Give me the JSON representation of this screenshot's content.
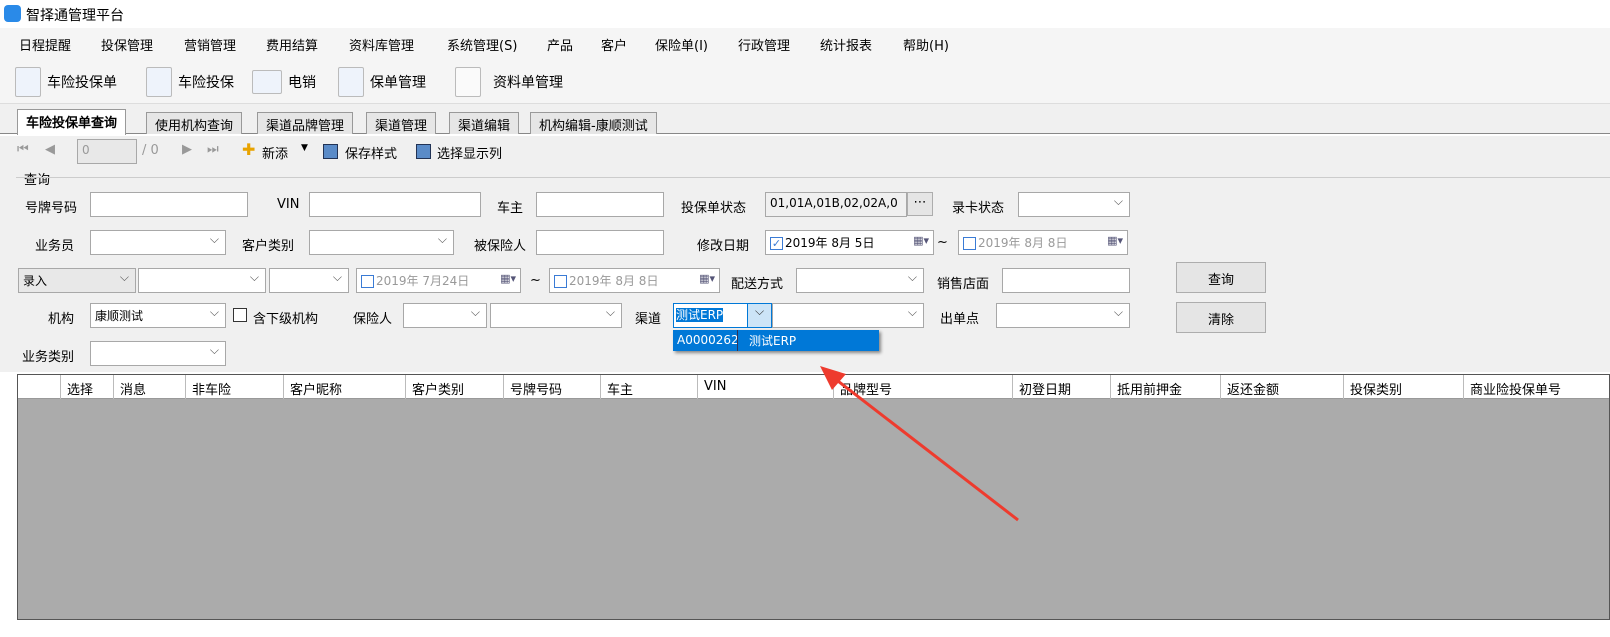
{
  "app": {
    "title": "智择通管理平台"
  },
  "menu": [
    "日程提醒",
    "投保管理",
    "营销管理",
    "费用结算",
    "资料库管理",
    "系统管理(S)",
    "产品",
    "客户",
    "保险单(I)",
    "行政管理",
    "统计报表",
    "帮助(H)"
  ],
  "toolbar": [
    "车险投保单",
    "车险投保",
    "电销",
    "保单管理",
    "资料单管理"
  ],
  "tabs": [
    "车险投保单查询",
    "使用机构查询",
    "渠道品牌管理",
    "渠道管理",
    "渠道编辑",
    "机构编辑-康顺测试"
  ],
  "nav": {
    "page": "0",
    "total": "/ 0",
    "new": "新添",
    "save_style": "保存样式",
    "select_cols": "选择显示列"
  },
  "form": {
    "group": "查询",
    "plate_label": "号牌号码",
    "vin_label": "VIN",
    "owner_label": "车主",
    "status_label": "投保单状态",
    "status_value": "01,01A,01B,02,02A,0",
    "card_label": "录卡状态",
    "salesman_label": "业务员",
    "cust_type_label": "客户类别",
    "insured_label": "被保险人",
    "modify_label": "修改日期",
    "modify_from": "2019年  8月  5日",
    "modify_to": "2019年  8月  8日",
    "tilde": "~",
    "entry_select": "录入",
    "entry_from": "2019年  7月24日",
    "entry_to": "2019年  8月  8日",
    "delivery_label": "配送方式",
    "store_label": "销售店面",
    "org_label": "机构",
    "org_value": "康顺测试",
    "sub_org_label": "含下级机构",
    "insurer_label": "保险人",
    "channel_label": "渠道",
    "channel_value": "测试ERP",
    "outlet_label": "出单点",
    "biz_type_label": "业务类别",
    "query_btn": "查询",
    "clear_btn": "清除"
  },
  "dropdown": {
    "code": "A0000262",
    "name": "测试ERP"
  },
  "grid": {
    "columns": [
      "选择",
      "消息",
      "非车险",
      "客户昵称",
      "客户类别",
      "号牌号码",
      "车主",
      "VIN",
      "品牌型号",
      "初登日期",
      "抵用前押金",
      "返还金额",
      "投保类别",
      "商业险投保单号"
    ]
  }
}
